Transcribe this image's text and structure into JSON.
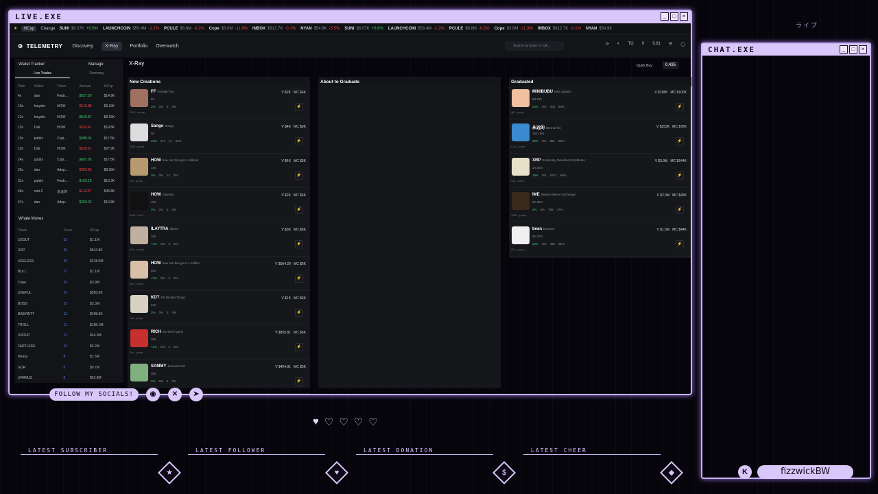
{
  "overlay": {
    "main_title": "LIVE.EXE",
    "chat_title": "CHAT.EXE",
    "socials": "FOLLOW MY SOCIALS!",
    "username": "fizzwickBW",
    "k_badge": "K",
    "deco": "ライブ",
    "labels": [
      "LATEST SUBSCRIBER",
      "LATEST FOLLOWER",
      "LATEST DONATION",
      "LATEST CHEER"
    ]
  },
  "ticker": {
    "mcap": "MCap",
    "change": "Change",
    "items": [
      {
        "name": "SUNI",
        "v": "$6.07K",
        "c": "+0.6%",
        "up": true
      },
      {
        "name": "LAUNCHCOIN",
        "v": "$59.4M",
        "c": "-1.2%",
        "up": false
      },
      {
        "name": "PCULE",
        "v": "$8.8M",
        "c": "-0.2%",
        "up": false
      },
      {
        "name": "Cope",
        "v": "$3.9M",
        "c": "-11.9%",
        "up": false
      },
      {
        "name": "INBOX",
        "v": "$912.7K",
        "c": "-0.1%",
        "up": false
      },
      {
        "name": "NYAN",
        "v": "$54.9K",
        "c": "-5.5%",
        "up": false
      },
      {
        "name": "SUNI",
        "v": "$6.07K",
        "c": "+0.6%",
        "up": true
      },
      {
        "name": "LAUNCHCOIN",
        "v": "$59.4M",
        "c": "-1.2%",
        "up": false
      },
      {
        "name": "PCULE",
        "v": "$8.8M",
        "c": "-0.2%",
        "up": false
      },
      {
        "name": "Cope",
        "v": "$3.9M",
        "c": "-11.9%",
        "up": false
      },
      {
        "name": "INBOX",
        "v": "$912.7K",
        "c": "-0.1%",
        "up": false
      },
      {
        "name": "NYAN",
        "v": "$54.9K",
        "c": "",
        "up": false
      }
    ]
  },
  "nav": {
    "logo": "TELEMETRY",
    "links": [
      "Discovery",
      "X-Ray",
      "Portfolio",
      "Overwatch"
    ],
    "search": "Search by ticker or CA...",
    "tg": "TG",
    "zero": "0",
    "balance": "9.81"
  },
  "side": {
    "wallet": "Wallet Tracker",
    "manage": "Manage",
    "tab1": "Live Trades",
    "tab2": "Summary",
    "headers": [
      "Date",
      "Wallet",
      "Token",
      "Amount",
      "MCap"
    ],
    "trades": [
      [
        "4s",
        "dan",
        "Fredr...",
        "$627.59",
        "$14.9K"
      ],
      [
        "10s",
        "Insyder",
        "HOW",
        "$516.88",
        "$9.19K"
      ],
      [
        "12s",
        "Insyder",
        "HOW",
        "$546.87",
        "$8.15K"
      ],
      [
        "13s",
        "Dali",
        "HOW",
        "$233.41",
        "$19.8K"
      ],
      [
        "15s",
        "publix",
        "Copi...",
        "$588.34",
        "$17.5K"
      ],
      [
        "19s",
        "Dali",
        "HOW",
        "$328.61",
        "$27.9K"
      ],
      [
        "24s",
        "publix",
        "Copi...",
        "$697.05",
        "$17.5K"
      ],
      [
        "26s",
        "dan",
        "Adop...",
        "$492.82",
        "$8.55K"
      ],
      [
        "31s",
        "publix",
        "Fredr...",
        "$103.19",
        "$13.3K"
      ],
      [
        "46s",
        "nob.2",
        "永远的",
        "$113.07",
        "$46.8K"
      ],
      [
        "47s",
        "dan",
        "Adop...",
        "$209.33",
        "$12.8K"
      ]
    ],
    "whale": "Whale Moves",
    "wheaders": [
      "Token",
      "Score",
      "MCap"
    ],
    "whales": [
      [
        "USDUT",
        "53",
        "$1.1M"
      ],
      [
        "XRP",
        "26",
        "$544.8K"
      ],
      [
        "USELESS",
        "26",
        "$218.0M"
      ],
      [
        "BULL",
        "27",
        "$1.1M"
      ],
      [
        "Cope",
        "26",
        "$3.9M"
      ],
      [
        "USEFUL",
        "15",
        "$565.0K"
      ],
      [
        "BOSS",
        "15",
        "$3.3M"
      ],
      [
        "BABYBITT",
        "12",
        "$408.6K"
      ],
      [
        "TROLL",
        "11",
        "$185.1M"
      ],
      [
        "USDUC",
        "11",
        "$44.0M"
      ],
      [
        "FARTLESS",
        "10",
        "$3.2M"
      ],
      [
        "Neasy",
        "8",
        "$1.5M"
      ],
      [
        "GOR",
        "8",
        "$9.7M"
      ],
      [
        "URANUS",
        "8",
        "$52.8M"
      ]
    ]
  },
  "xray": {
    "title": "X-Ray",
    "quick": "Quick Buy",
    "amt": "0.435",
    "col1": "New Creations",
    "col2": "About to Graduate",
    "col3": "Graduated"
  },
  "creations": [
    {
      "name": "FF",
      "sub": "Foreign Fox",
      "cap": "DDC...pump",
      "age": "9s",
      "s1": "3%",
      "s2": "0%",
      "s3": "6",
      "s4": "0%",
      "v": "V $2K",
      "mc": "MC $6K",
      "color": "#a07060"
    },
    {
      "name": "Sango",
      "sub": "Sango",
      "cap": "7EB...pump",
      "age": "9s",
      "s1": "20%",
      "s2": "2%",
      "s3": "17",
      "s4": "41%",
      "v": "V $4K",
      "mc": "MC $9K",
      "color": "#dcdcdc"
    },
    {
      "name": "HOW",
      "sub": "how can this go to millions",
      "cap": "2rb...pump",
      "age": "14s",
      "s1": "3%",
      "s2": "0%",
      "s3": "12",
      "s4": "0%",
      "v": "V $4K",
      "mc": "MC $6K",
      "color": "#b89a70"
    },
    {
      "name": "HOW",
      "sub": "Howcoin",
      "cap": "6eW...ebc3",
      "age": "18s",
      "s1": "3%",
      "s2": "0%",
      "s3": "6",
      "s4": "0%",
      "v": "V $2K",
      "mc": "MC $6K",
      "color": "#111111"
    },
    {
      "name": "ILAYTRA",
      "sub": "Ilaytra",
      "cap": "6Ce...pump",
      "age": "18s",
      "s1": "<1%",
      "s2": "0%",
      "s3": "2",
      "s4": "0%",
      "v": "V $3K",
      "mc": "MC $6K",
      "color": "#c0b0a0"
    },
    {
      "name": "HOW",
      "sub": "how can this go to 1 million",
      "cap": "6xU...pump",
      "age": "20s",
      "s1": "<1%",
      "s2": "0%",
      "s3": "2",
      "s4": "0%",
      "v": "V $564.20",
      "mc": "MC $6K",
      "color": "#d8c0a8"
    },
    {
      "name": "KDT",
      "sub": "Kill Donald Trump",
      "cap": "Clp...pump",
      "age": "22s",
      "s1": "2%",
      "s2": "0%",
      "s3": "5",
      "s4": "0%",
      "v": "V $1K",
      "mc": "MC $6K",
      "color": "#d8d0c0"
    },
    {
      "name": "RICH",
      "sub": "Get Rich Quick",
      "cap": "7rH...pump",
      "age": "29s",
      "s1": "<1%",
      "s2": "0%",
      "s3": "2",
      "s4": "0%",
      "v": "V $855.81",
      "mc": "MC $6K",
      "color": "#c83030"
    },
    {
      "name": "SAMMY",
      "sub": "Success Kid",
      "cap": "",
      "age": "39s",
      "s1": "3%",
      "s2": "0%",
      "s3": "4",
      "s4": "0%",
      "v": "V $404.91",
      "mc": "MC $6K",
      "color": "#80b080"
    }
  ],
  "graduated": [
    {
      "name": "MINIBUBU",
      "sub": "Mini Labubu",
      "cap": "4j0...pump",
      "age": "5d 19h",
      "s1": "22%",
      "s2": "0%",
      "s3": "403",
      "s4": "50%",
      "v": "V $158K",
      "mc": "MC $100K",
      "color": "#f0c0a0"
    },
    {
      "name": "永远的",
      "sub": "Eternal fire",
      "cap": "CXq...bonk",
      "age": "10m 36s",
      "s1": "20%",
      "s2": "0%",
      "s3": "381",
      "s4": "85%",
      "v": "V $353K",
      "mc": "MC $78K",
      "color": "#3a8ad0"
    },
    {
      "name": "XRP",
      "sub": "Extremely Retarded Prostitutes",
      "cap": "SSj...pump",
      "age": "1h 20m",
      "s1": "16%",
      "s2": "0%",
      "s3": "1571",
      "s4": "55%",
      "v": "V $3.9M",
      "mc": "MC $544K",
      "color": "#e8e0c8"
    },
    {
      "name": "IME",
      "sub": "Internet Meme Exchange",
      "cap": "7WR...pump",
      "age": "6h 45m",
      "s1": "2%",
      "s2": "0%",
      "s3": "708",
      "s4": "47%",
      "v": "V $2.0M",
      "mc": "MC $49K",
      "color": "#3a2a1a"
    },
    {
      "name": "bean",
      "sub": "beancat",
      "cap": "6DI...pump",
      "age": "6h 27m",
      "s1": "22%",
      "s2": "0%",
      "s3": "485",
      "s4": "51%",
      "v": "V $1.5M",
      "mc": "MC $44K",
      "color": "#f0f0f0"
    }
  ],
  "colors": {
    "accent": "#d9c7fb",
    "green": "#3ecf6e",
    "red": "#ef4a4a",
    "yellow": "#e0c040"
  }
}
